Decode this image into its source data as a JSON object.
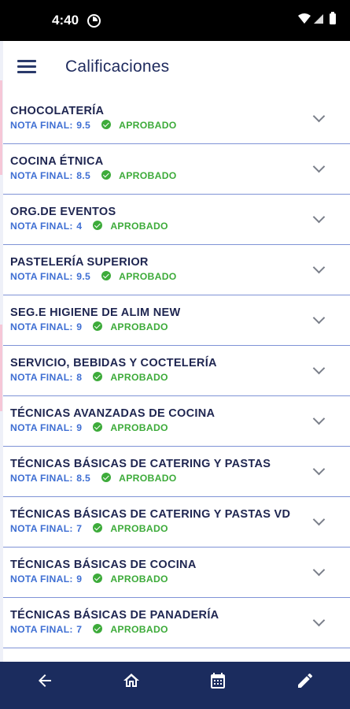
{
  "status_bar": {
    "time": "4:40"
  },
  "app_bar": {
    "title": "Calificaciones",
    "menu_icon": "menu-icon"
  },
  "grade_label": "NOTA FINAL:",
  "status_color": "#3dab3a",
  "accent_color": "#1b2c5e",
  "courses": [
    {
      "name": "CHOCOLATERÍA",
      "grade": "9.5",
      "status": "APROBADO"
    },
    {
      "name": "COCINA ÉTNICA",
      "grade": "8.5",
      "status": "APROBADO"
    },
    {
      "name": "ORG.DE EVENTOS",
      "grade": "4",
      "status": "APROBADO"
    },
    {
      "name": "PASTELERÍA SUPERIOR",
      "grade": "9.5",
      "status": "APROBADO"
    },
    {
      "name": "SEG.E HIGIENE DE ALIM NEW",
      "grade": "9",
      "status": "APROBADO"
    },
    {
      "name": "SERVICIO, BEBIDAS Y COCTELERÍA",
      "grade": "8",
      "status": "APROBADO"
    },
    {
      "name": "TÉCNICAS AVANZADAS DE COCINA",
      "grade": "9",
      "status": "APROBADO"
    },
    {
      "name": "TÉCNICAS BÁSICAS DE CATERING Y PASTAS",
      "grade": "8.5",
      "status": "APROBADO"
    },
    {
      "name": "TÉCNICAS BÁSICAS DE CATERING Y PASTAS VD",
      "grade": "7",
      "status": "APROBADO"
    },
    {
      "name": "TÉCNICAS BÁSICAS DE COCINA",
      "grade": "9",
      "status": "APROBADO"
    },
    {
      "name": "TÉCNICAS BÁSICAS DE PANADERÍA",
      "grade": "7",
      "status": "APROBADO"
    }
  ],
  "bottom_nav": [
    "back-arrow-icon",
    "home-icon",
    "calendar-icon",
    "edit-pencil-icon"
  ]
}
